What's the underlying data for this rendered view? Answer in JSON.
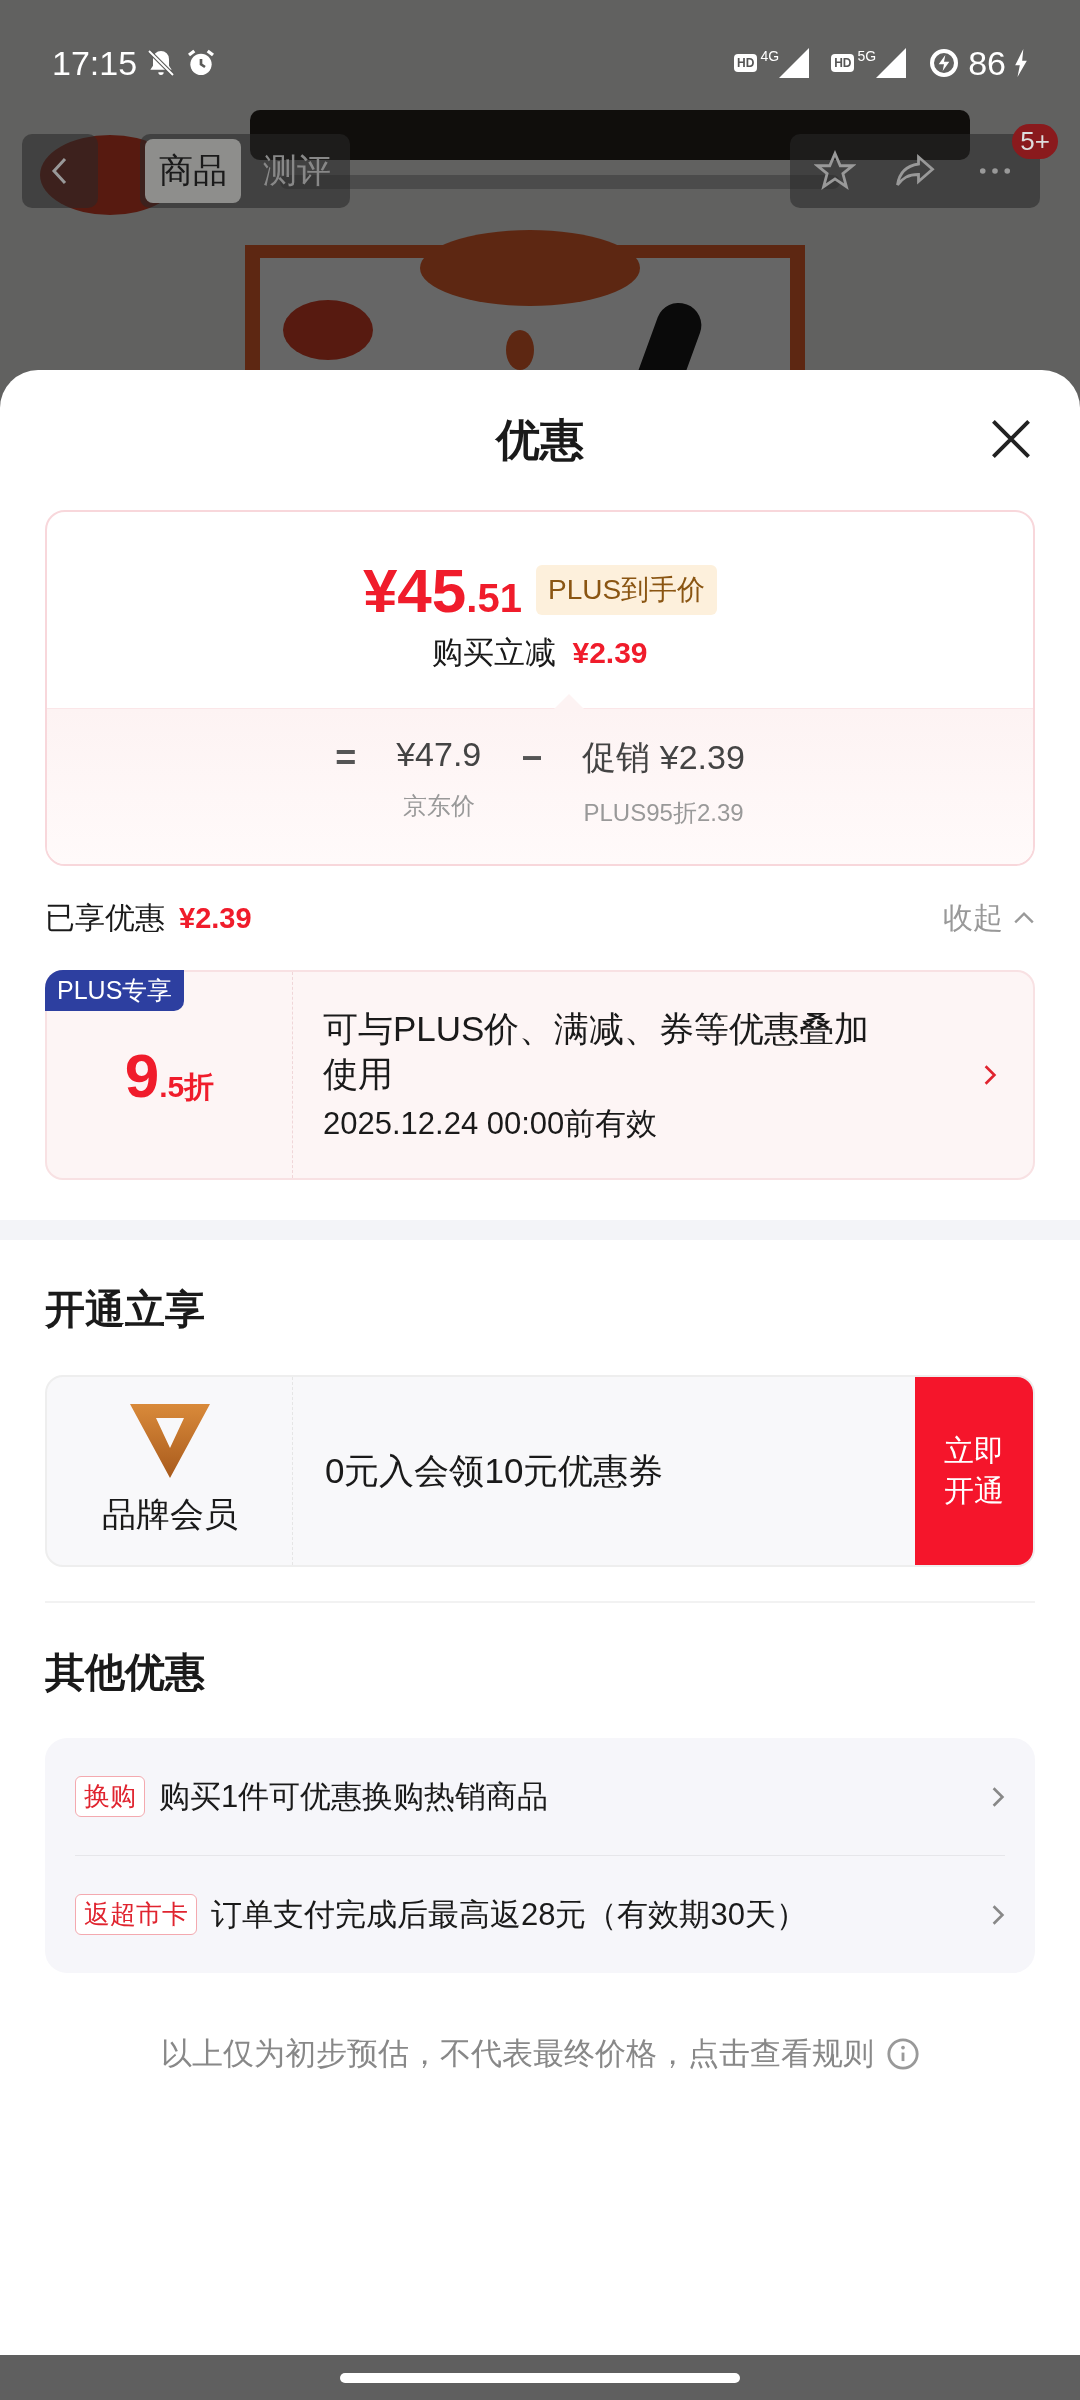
{
  "status_bar": {
    "time": "17:15",
    "networks": [
      {
        "hd": "HD",
        "type": "4G"
      },
      {
        "hd": "HD",
        "type": "5G"
      }
    ],
    "battery": "86"
  },
  "nav": {
    "tabs": [
      {
        "label": "商品",
        "selected": true
      },
      {
        "label": "测评",
        "selected": false
      }
    ],
    "badge": "5+"
  },
  "sheet": {
    "title": "优惠"
  },
  "price_card": {
    "price_main": "¥45",
    "price_decimal": ".51",
    "price_tag": "PLUS到手价",
    "saving_label": "购买立减",
    "saving_amount": "¥2.39",
    "formula": [
      {
        "kind": "operator",
        "symbol": "="
      },
      {
        "kind": "term",
        "value": "¥47.9",
        "caption": "京东价"
      },
      {
        "kind": "operator",
        "symbol": "−"
      },
      {
        "kind": "term",
        "value": "促销 ¥2.39",
        "caption": "PLUS95折2.39"
      }
    ]
  },
  "enjoyed": {
    "label": "已享优惠",
    "amount": "¥2.39",
    "toggle": "收起"
  },
  "coupons": [
    {
      "tag": "PLUS专享",
      "value_main": "9",
      "value_suffix": ".5折",
      "description": "可与PLUS价、满减、券等优惠叠加使用",
      "validity": "2025.12.24 00:00前有效"
    }
  ],
  "membership": {
    "heading": "开通立享",
    "name": "品牌会员",
    "offer": "0元入会领10元优惠券",
    "button": "立即开通"
  },
  "other": {
    "heading": "其他优惠",
    "items": [
      {
        "tag": "换购",
        "text": "购买1件可优惠换购热销商品"
      },
      {
        "tag": "返超市卡",
        "text": "订单支付完成后最高返28元（有效期30天）"
      }
    ]
  },
  "footnote": "以上仅为初步预估，不代表最终价格，点击查看规则"
}
